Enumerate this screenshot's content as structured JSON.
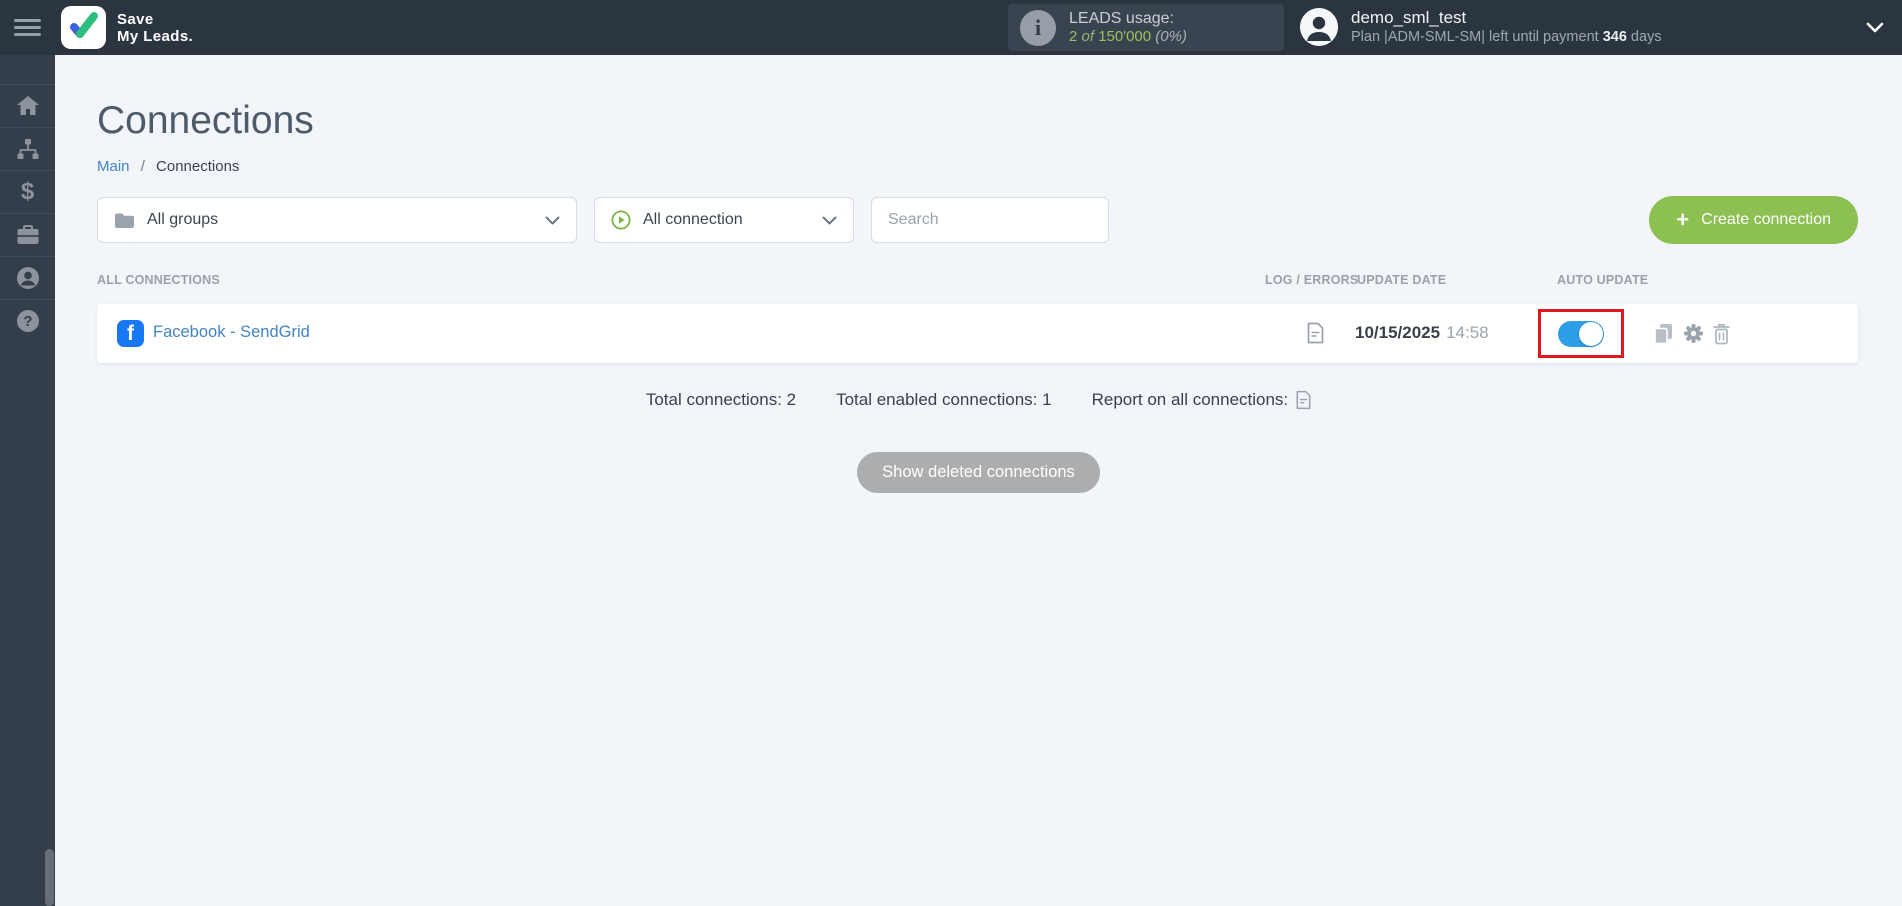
{
  "header": {
    "brand_line1": "Save",
    "brand_line2": "My Leads.",
    "leads_usage": {
      "label": "LEADS usage:",
      "used": "2",
      "of_word": "of",
      "total": "150'000",
      "percent": "(0%)"
    },
    "user": {
      "name": "demo_sml_test",
      "plan_prefix": "Plan |ADM-SML-SM| left until payment ",
      "days_value": "346",
      "days_suffix": " days"
    }
  },
  "sidebar": {
    "items": [
      {
        "icon": "home-icon"
      },
      {
        "icon": "sitemap-icon"
      },
      {
        "icon": "dollar-icon"
      },
      {
        "icon": "briefcase-icon"
      },
      {
        "icon": "person-icon"
      },
      {
        "icon": "help-icon"
      }
    ],
    "dollar_glyph": "$"
  },
  "page": {
    "title": "Connections",
    "breadcrumb": {
      "main": "Main",
      "separator": "/",
      "current": "Connections"
    }
  },
  "filters": {
    "groups_dropdown": "All groups",
    "connection_dropdown": "All connection",
    "search_placeholder": "Search",
    "create_plus": "+",
    "create_button": "Create connection"
  },
  "table": {
    "headers": {
      "connections": "ALL CONNECTIONS",
      "log_errors": "LOG / ERRORS",
      "update_date": "UPDATE DATE",
      "auto_update": "AUTO UPDATE"
    },
    "rows": [
      {
        "service_icon": "facebook-icon",
        "facebook_glyph": "f",
        "name": "Facebook - SendGrid",
        "date": "10/15/2025",
        "time": "14:58",
        "auto_update": true
      }
    ]
  },
  "summary": {
    "total": "Total connections: 2",
    "enabled": "Total enabled connections: 1",
    "report": "Report on all connections:"
  },
  "actions": {
    "show_deleted": "Show deleted connections"
  },
  "colors": {
    "accent_green": "#8CC152",
    "toggle_blue": "#2F9EE8",
    "highlight_red": "#E0191F",
    "link_blue": "#4284C4",
    "facebook_blue": "#1877F2",
    "header_bg": "#2B3540",
    "sidebar_bg": "#343E4B"
  }
}
